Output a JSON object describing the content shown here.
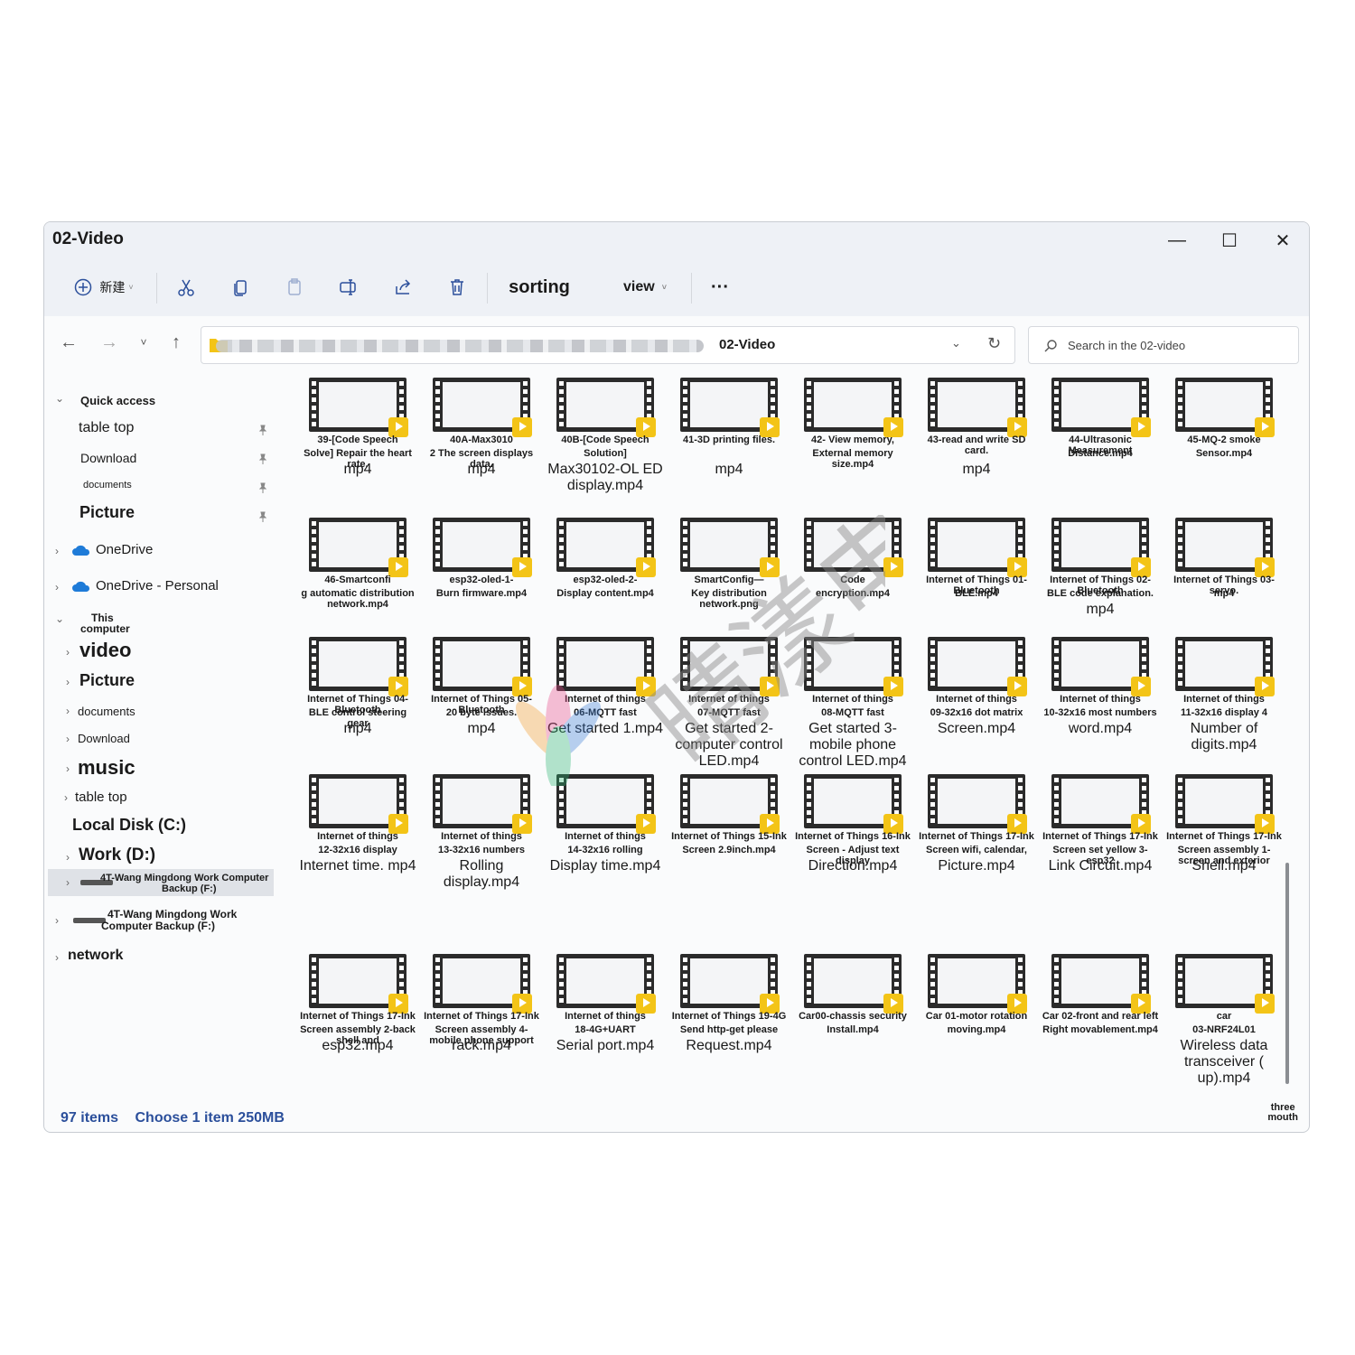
{
  "window": {
    "title": "02-Video",
    "minimize": "—",
    "maximize": "☐",
    "close": "✕"
  },
  "toolbar": {
    "new_label": "新建",
    "sort_label": "sorting",
    "view_label": "view",
    "more_label": "···"
  },
  "address": {
    "current": "02-Video",
    "search_placeholder": "Search in the 02-video"
  },
  "sidebar": {
    "quick_access": "Quick access",
    "table_top": "table top",
    "download": "Download",
    "documents": "documents",
    "picture": "Picture",
    "onedrive": "OneDrive",
    "onedrive_personal": "OneDrive - Personal",
    "this_computer_1": "This",
    "this_computer_2": "computer",
    "video": "video",
    "picture2": "Picture",
    "documents2": "documents",
    "download2": "Download",
    "music": "music",
    "table_top2": "table top",
    "local_disk": "Local Disk (C:)",
    "work_disk": "Work (D:)",
    "backup_sel_1": "4T-Wang Mingdong Work Computer",
    "backup_sel_2": "Backup (F:)",
    "backup_1": "4T-Wang Mingdong Work",
    "backup_2": "Computer Backup (F:)",
    "network": "network"
  },
  "files": [
    {
      "l1": "39-[Code Speech",
      "l2": "Solve] Repair the heart rate.",
      "l3": "mp4"
    },
    {
      "l1": "40A-Max3010",
      "l2": "2 The screen displays data.",
      "l3": "mp4"
    },
    {
      "l1": "40B-[Code Speech",
      "l2": "Solution]",
      "l3": "Max30102-OL ED display.mp4"
    },
    {
      "l1": "41-3D printing files.",
      "l2": "",
      "l3": "mp4"
    },
    {
      "l1": "42- View memory,",
      "l2": "External memory size.mp4",
      "l3": ""
    },
    {
      "l1": "43-read and write SD card.",
      "l2": "",
      "l3": "mp4"
    },
    {
      "l1": "44-Ultrasonic Measurement",
      "l2": "Distance.mp4",
      "l3": ""
    },
    {
      "l1": "45-MQ-2 smoke",
      "l2": "Sensor.mp4",
      "l3": ""
    },
    {
      "l1": "46-Smartconfi",
      "l2": "g automatic distribution network.mp4",
      "l3": ""
    },
    {
      "l1": "esp32-oled-1-",
      "l2": "Burn firmware.mp4",
      "l3": ""
    },
    {
      "l1": "esp32-oled-2-",
      "l2": "Display content.mp4",
      "l3": ""
    },
    {
      "l1": "SmartConfig—",
      "l2": "Key distribution network.png",
      "l3": ""
    },
    {
      "l1": "Code",
      "l2": "encryption.mp4",
      "l3": ""
    },
    {
      "l1": "Internet of Things 01-Bluetooth",
      "l2": "BLE.mp4",
      "l3": ""
    },
    {
      "l1": "Internet of Things 02-Bluetooth",
      "l2": "BLE code explanation.",
      "l3": "mp4"
    },
    {
      "l1": "Internet of Things 03-servo.",
      "l2": "mp4",
      "l3": ""
    },
    {
      "l1": "Internet of Things 04-Bluetooth",
      "l2": "BLE control steering gear",
      "l3": "mp4"
    },
    {
      "l1": "Internet of Things 05-Bluetooth",
      "l2": "20 byte issues.",
      "l3": "mp4"
    },
    {
      "l1": "Internet of things",
      "l2": "06-MQTT fast",
      "l3": "Get started 1.mp4"
    },
    {
      "l1": "Internet of things",
      "l2": "07-MQTT fast",
      "l3": "Get started 2-computer control LED.mp4"
    },
    {
      "l1": "Internet of things",
      "l2": "08-MQTT fast",
      "l3": "Get started 3-mobile phone control LED.mp4"
    },
    {
      "l1": "Internet of things",
      "l2": "09-32x16 dot matrix",
      "l3": "Screen.mp4"
    },
    {
      "l1": "Internet of things",
      "l2": "10-32x16 most numbers",
      "l3": "word.mp4"
    },
    {
      "l1": "Internet of things",
      "l2": "11-32x16 display 4",
      "l3": "Number of digits.mp4"
    },
    {
      "l1": "Internet of things",
      "l2": "12-32x16 display",
      "l3": "Internet time. mp4"
    },
    {
      "l1": "Internet of things",
      "l2": "13-32x16 numbers",
      "l3": "Rolling display.mp4"
    },
    {
      "l1": "Internet of things",
      "l2": "14-32x16 rolling",
      "l3": "Display time.mp4"
    },
    {
      "l1": "Internet of Things 15-Ink",
      "l2": "Screen 2.9inch.mp4",
      "l3": ""
    },
    {
      "l1": "Internet of Things 16-Ink",
      "l2": "Screen - Adjust text display",
      "l3": "Direction.mp4"
    },
    {
      "l1": "Internet of Things 17-Ink",
      "l2": "Screen wifi, calendar,",
      "l3": "Picture.mp4"
    },
    {
      "l1": "Internet of Things 17-Ink",
      "l2": "Screen set yellow 3-esp32",
      "l3": "Link Circuit.mp4"
    },
    {
      "l1": "Internet of Things 17-Ink",
      "l2": "Screen assembly 1-screen and exterior",
      "l3": "Shell.mp4"
    },
    {
      "l1": "Internet of Things 17-Ink",
      "l2": "Screen assembly 2-back shell and",
      "l3": "esp32.mp4"
    },
    {
      "l1": "Internet of Things 17-Ink",
      "l2": "Screen assembly 4-mobile phone support",
      "l3": "rack.mp4"
    },
    {
      "l1": "Internet of things",
      "l2": "18-4G+UART",
      "l3": "Serial port.mp4"
    },
    {
      "l1": "Internet of Things 19-4G",
      "l2": "Send http-get please",
      "l3": "Request.mp4"
    },
    {
      "l1": "Car00-chassis security",
      "l2": "Install.mp4",
      "l3": ""
    },
    {
      "l1": "Car 01-motor rotation",
      "l2": "moving.mp4",
      "l3": ""
    },
    {
      "l1": "Car 02-front and rear left",
      "l2": "Right movablement.mp4",
      "l3": ""
    },
    {
      "l1": "car",
      "l2": "03-NRF24L01",
      "l3": "Wireless data transceiver ( up).mp4"
    }
  ],
  "status": {
    "count": "97 items",
    "selection": "Choose 1 item 250MB",
    "corner_1": "three",
    "corner_2": "mouth"
  },
  "watermark_text": "晴漾电子",
  "colors": {
    "accent": "#2b4f9b",
    "badge": "#f3c417",
    "film": "#2b2b2b"
  }
}
